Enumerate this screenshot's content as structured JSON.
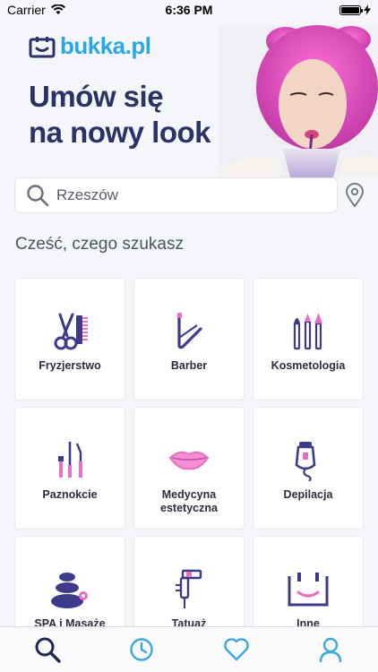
{
  "status_bar": {
    "carrier": "Carrier",
    "time": "6:36 PM"
  },
  "logo": {
    "text": "bukka.pl"
  },
  "hero": {
    "headline_line1": "Umów się",
    "headline_line2": "na nowy look"
  },
  "search": {
    "value": "Rzeszów",
    "placeholder": "Rzeszów"
  },
  "greeting": "Cześć, czego szukasz",
  "categories": [
    {
      "label": "Fryzjerstwo",
      "icon": "scissors-comb-icon"
    },
    {
      "label": "Barber",
      "icon": "razor-icon"
    },
    {
      "label": "Kosmetologia",
      "icon": "makeup-brushes-icon"
    },
    {
      "label": "Paznokcie",
      "icon": "nail-tools-icon"
    },
    {
      "label": "Medycyna estetyczna",
      "icon": "lips-icon"
    },
    {
      "label": "Depilacja",
      "icon": "epilator-icon"
    },
    {
      "label": "SPA i Masaże",
      "icon": "spa-stones-icon"
    },
    {
      "label": "Tatuaż",
      "icon": "tattoo-machine-icon"
    },
    {
      "label": "Inne",
      "icon": "other-box-icon"
    }
  ],
  "tabs": [
    {
      "name": "search",
      "icon": "search-icon",
      "active": true
    },
    {
      "name": "history",
      "icon": "clock-icon",
      "active": false
    },
    {
      "name": "favorites",
      "icon": "heart-icon",
      "active": false
    },
    {
      "name": "profile",
      "icon": "user-icon",
      "active": false
    }
  ],
  "colors": {
    "brand_blue": "#29a8e6",
    "headline_navy": "#2a3266",
    "icon_purple": "#3d3a8c",
    "icon_pink": "#e86fc6",
    "tab_active": "#1f2a55",
    "tab_inactive": "#3aa8e0"
  }
}
